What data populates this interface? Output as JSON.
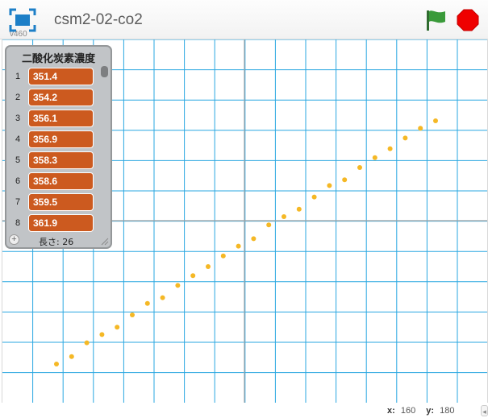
{
  "header": {
    "title": "csm2-02-co2",
    "version": "v460"
  },
  "list": {
    "title": "二酸化炭素濃度",
    "length_label": "長さ: 26",
    "items": [
      {
        "index": "1",
        "value": "351.4"
      },
      {
        "index": "2",
        "value": "354.2"
      },
      {
        "index": "3",
        "value": "356.1"
      },
      {
        "index": "4",
        "value": "356.9"
      },
      {
        "index": "5",
        "value": "358.3"
      },
      {
        "index": "6",
        "value": "358.6"
      },
      {
        "index": "7",
        "value": "359.5"
      },
      {
        "index": "8",
        "value": "361.9"
      }
    ]
  },
  "coords": {
    "x_label": "x:",
    "x_value": "160",
    "y_label": "y:",
    "y_value": "180"
  },
  "colors": {
    "grid": "#29a7e1",
    "axis": "#a5a5a5",
    "dot": "#f5b825",
    "list_item": "#cc5a1f",
    "flag": "#3a9a3a",
    "stop": "#ef0000"
  }
}
